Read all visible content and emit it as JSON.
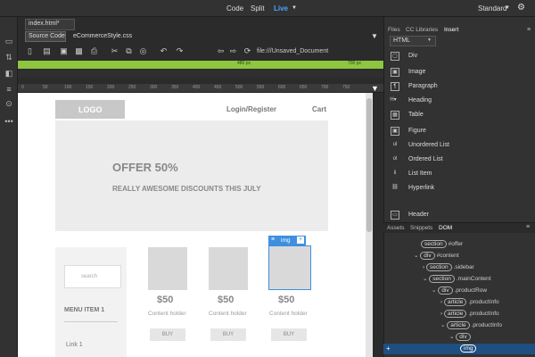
{
  "top": {
    "view_code": "Code",
    "view_split": "Split",
    "view_live": "Live",
    "workspace": "Standard"
  },
  "doc": {
    "file_tab": "index.html*",
    "source_code": "Source Code",
    "related_file": "eCommerceStyle.css",
    "address": "file:///Unsaved_Document"
  },
  "mq": {
    "left": "480 px",
    "right": "700 px"
  },
  "ruler": [
    "0",
    "50",
    "100",
    "150",
    "200",
    "250",
    "300",
    "350",
    "400",
    "450",
    "500",
    "550",
    "600",
    "650",
    "700",
    "750"
  ],
  "page": {
    "logo": "LOGO",
    "login": "Login/Register",
    "cart": "Cart",
    "offer": "OFFER 50%",
    "offer_sub": "REALLY AWESOME DISCOUNTS THIS JULY",
    "search_placeholder": "search",
    "menu_title": "MENU ITEM 1",
    "link1": "Link 1",
    "price1": "$50",
    "price2": "$50",
    "price3": "$50",
    "holder": "Content holder",
    "buy": "BUY",
    "img_badge": "img"
  },
  "panel_tabs": {
    "files": "Files",
    "cc": "CC Libraries",
    "insert": "Insert",
    "html": "HTML"
  },
  "insert_items": [
    "Div",
    "Image",
    "Paragraph",
    "Heading",
    "Table",
    "Figure",
    "Unordered List",
    "Ordered List",
    "List Item",
    "Hyperlink",
    "Header"
  ],
  "lower_tabs": {
    "assets": "Assets",
    "snippets": "Snippets",
    "dom": "DOM"
  },
  "dom_rows": [
    {
      "tag": "section",
      "sel": "#offer"
    },
    {
      "tag": "div",
      "sel": "#content"
    },
    {
      "tag": "section",
      "sel": ".sidebar"
    },
    {
      "tag": "section",
      "sel": ".mainContent"
    },
    {
      "tag": "div",
      "sel": ".productRow"
    },
    {
      "tag": "article",
      "sel": ".productInfo"
    },
    {
      "tag": "article",
      "sel": ".productInfo"
    },
    {
      "tag": "article",
      "sel": ".productInfo"
    },
    {
      "tag": "div",
      "sel": ""
    },
    {
      "tag": "img",
      "sel": ""
    }
  ]
}
